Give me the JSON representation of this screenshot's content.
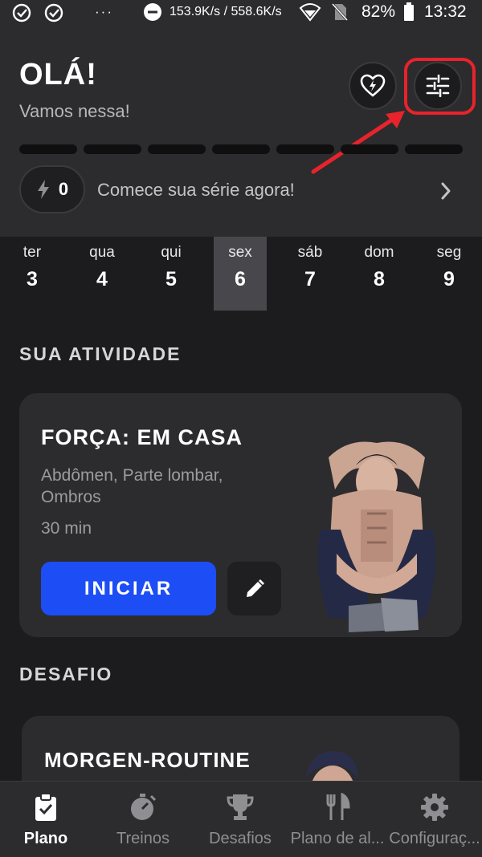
{
  "status_bar": {
    "network_speed": "153.9K/s / 558.6K/s",
    "battery": "82%",
    "time": "13:32",
    "dots": "···"
  },
  "header": {
    "title": "OLÁ!",
    "subtitle": "Vamos nessa!",
    "streak_count": "0",
    "streak_text": "Comece sua série agora!",
    "health_icon": "heart-bolt-icon",
    "filter_icon": "sliders-icon"
  },
  "days": [
    {
      "name": "ter",
      "num": "3"
    },
    {
      "name": "qua",
      "num": "4"
    },
    {
      "name": "qui",
      "num": "5"
    },
    {
      "name": "sex",
      "num": "6"
    },
    {
      "name": "sáb",
      "num": "7"
    },
    {
      "name": "dom",
      "num": "8"
    },
    {
      "name": "seg",
      "num": "9"
    }
  ],
  "selected_day": "sex",
  "activity": {
    "section_title": "SUA ATIVIDADE",
    "card_title": "FORÇA: EM CASA",
    "muscles": "Abdômen, Parte lombar, Ombros",
    "duration": "30 min",
    "start_label": "INICIAR"
  },
  "challenge": {
    "section_title": "DESAFIO",
    "card_title": "MORGEN-ROUTINE"
  },
  "nav": [
    {
      "label": "Plano",
      "icon": "clipboard-check-icon",
      "active": true
    },
    {
      "label": "Treinos",
      "icon": "stopwatch-icon",
      "active": false
    },
    {
      "label": "Desafios",
      "icon": "trophy-icon",
      "active": false
    },
    {
      "label": "Plano de al...",
      "icon": "fork-knife-icon",
      "active": false
    },
    {
      "label": "Configuraç...",
      "icon": "gear-icon",
      "active": false
    }
  ],
  "colors": {
    "accent_blue": "#1d4ef5",
    "highlight_red": "#e8232b",
    "background": "#1c1c1e",
    "surface": "#2c2c2e"
  }
}
